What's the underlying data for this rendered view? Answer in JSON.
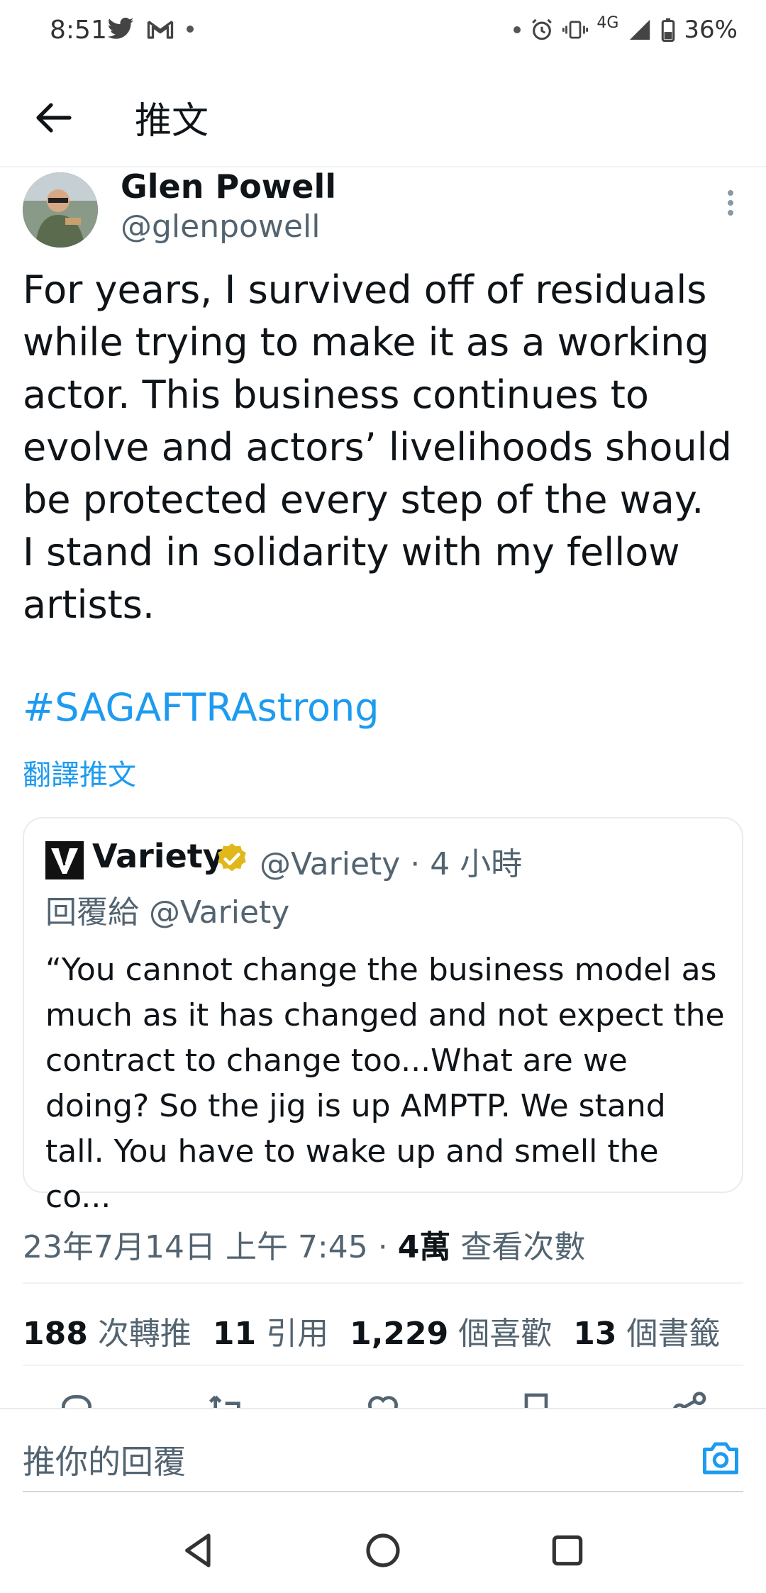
{
  "status_bar": {
    "time": "8:51",
    "network": "4G",
    "battery": "36%",
    "icons_left": [
      "twitter-bird-icon",
      "gmail-icon",
      "dot-icon"
    ],
    "icons_right": [
      "dot-icon",
      "alarm-icon",
      "vibrate-icon",
      "4g-signal-icon",
      "signal-strength-icon",
      "battery-icon"
    ]
  },
  "appbar": {
    "title": "推文",
    "back_icon": "arrow-left-icon"
  },
  "tweet": {
    "author_name": "Glen Powell",
    "author_handle": "@glenpowell",
    "text": "For years, I survived off of residuals\nwhile trying to make it as a working\nactor. This business continues to\nevolve and actors’ livelihoods should\nbe protected every step of the way.\nI stand in solidarity with my fellow\nartists.",
    "hashtag": "#SAGAFTRAstrong",
    "translate_label": "翻譯推文",
    "timestamp": "23年7月14日 上午 7:45 · ",
    "views_count": "4萬",
    "views_label": " 查看次數"
  },
  "quote": {
    "name": "Variety",
    "handle_time": "@Variety · 4 小時",
    "reply_to": "回覆給 @Variety",
    "text": "“You cannot change the business model as\nmuch as it has changed and not expect the\ncontract to change too...What are we\ndoing? So the jig is up AMPTP. We stand\ntall. You have to wake up and smell the co..."
  },
  "stats": {
    "retweets_count": "188",
    "retweets_label": "次轉推",
    "quotes_count": "11",
    "quotes_label": "引用",
    "likes_count": "1,229",
    "likes_label": "個喜歡",
    "bookmarks_count": "13",
    "bookmarks_label": "個書籤"
  },
  "actions": [
    "reply-icon",
    "retweet-icon",
    "like-icon",
    "bookmark-icon",
    "share-icon"
  ],
  "reply_bar": {
    "placeholder": "推你的回覆"
  },
  "colors": {
    "accent": "#1d9bf0",
    "secondary_text": "#536471",
    "verified_gold": "#e2b719"
  }
}
